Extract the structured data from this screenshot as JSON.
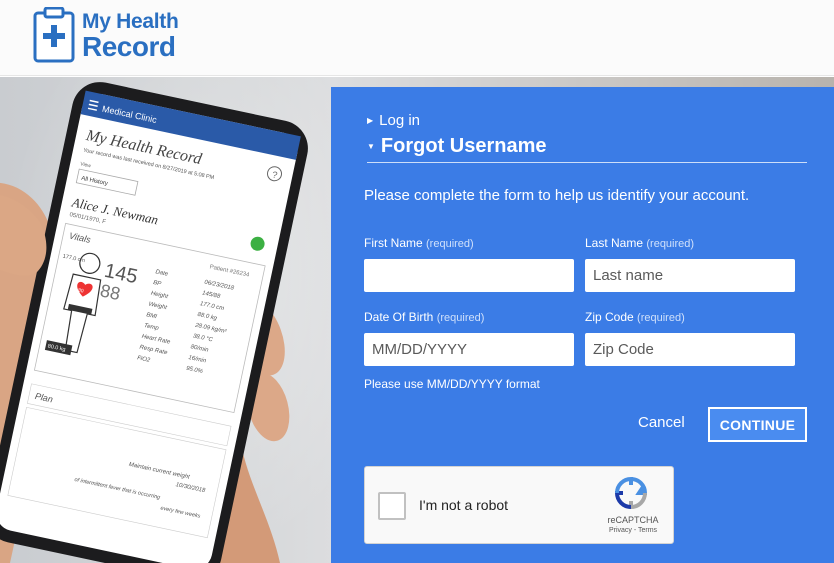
{
  "header": {
    "logo_line1": "My Health",
    "logo_line2": "Record"
  },
  "phone": {
    "clinic": "Medical Clinic",
    "title": "My Health Record",
    "subtitle": "Your record was last received on 8/27/2019 at 5:08 PM",
    "view_label": "View",
    "view_value": "All History",
    "patient_name": "Alice J. Newman",
    "patient_dob": "05/01/1970, F",
    "vitals_label": "Vitals",
    "patient_id": "Patient #26234",
    "height_display": "177.0 cm",
    "bp_big": "145",
    "bp_small": "88",
    "weight_tag": "80.0 kg",
    "bpm_tag": "80",
    "vital_rows": [
      {
        "label": "Date",
        "value": "06/23/2018"
      },
      {
        "label": "BP",
        "value": "145/88"
      },
      {
        "label": "Height",
        "value": "177.0 cm"
      },
      {
        "label": "Weight",
        "value": "88.0 kg"
      },
      {
        "label": "BMI",
        "value": "28.09 kg/m²"
      },
      {
        "label": "Temp",
        "value": "38.0 °C"
      },
      {
        "label": "Heart Rate",
        "value": "80/min"
      },
      {
        "label": "Resp Rate",
        "value": "16/min"
      },
      {
        "label": "FiO2",
        "value": "95.0%"
      }
    ],
    "plan_label": "Plan",
    "plan_line1": "Maintain current weight",
    "plan_date": "10/30/2018",
    "plan_line2": "of intermittent fever that is occurring",
    "plan_line3": "every few weeks"
  },
  "form": {
    "nav_login": "Log in",
    "nav_forgot": "Forgot Username",
    "intro": "Please complete the form to help us identify your account.",
    "required_tag": "(required)",
    "first_name": {
      "label": "First Name",
      "value": "",
      "placeholder": ""
    },
    "last_name": {
      "label": "Last Name",
      "value": "",
      "placeholder": "Last name"
    },
    "dob": {
      "label": "Date Of Birth",
      "value": "",
      "placeholder": "MM/DD/YYYY"
    },
    "zip": {
      "label": "Zip Code",
      "value": "",
      "placeholder": "Zip Code"
    },
    "hint": "Please use MM/DD/YYYY format",
    "cancel_label": "Cancel",
    "continue_label": "CONTINUE"
  },
  "captcha": {
    "label": "I'm not a robot",
    "brand": "reCAPTCHA",
    "links": "Privacy - Terms"
  },
  "colors": {
    "brand_blue": "#2a6fc1",
    "panel_blue": "#3b7ce6",
    "button_blue": "#4a8cf0"
  },
  "icons": {
    "logo": "clipboard-plus-icon",
    "login_arrow": "triangle-right-icon",
    "forgot_arrow": "triangle-down-icon",
    "captcha_logo": "recaptcha-logo-icon"
  }
}
